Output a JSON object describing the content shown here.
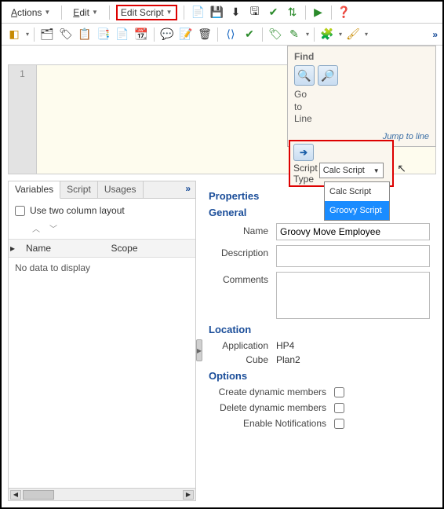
{
  "menubar": {
    "actions": "Actions",
    "actions_ul": "A",
    "edit": "Edit",
    "edit_ul": "E",
    "edit_script": "Edit Script"
  },
  "find": {
    "label": "Find",
    "go": "Go",
    "to": "to",
    "line": "Line",
    "jump": "Jump to line"
  },
  "script_type": {
    "label1": "Script",
    "label2": "Type",
    "selected": "Calc Script",
    "options": {
      "calc": "Calc Script",
      "groovy": "Groovy Script"
    }
  },
  "code": {
    "line1": "1"
  },
  "left": {
    "tabs": {
      "variables": "Variables",
      "script": "Script",
      "usages": "Usages"
    },
    "two_col": "Use two column layout",
    "cols": {
      "name": "Name",
      "scope": "Scope"
    },
    "no_data": "No data to display"
  },
  "props": {
    "properties": "Properties",
    "general": "General",
    "name_label": "Name",
    "name_value": "Groovy Move Employee",
    "description_label": "Description",
    "description_value": "",
    "comments_label": "Comments",
    "comments_value": "",
    "location": "Location",
    "application_label": "Application",
    "application_value": "HP4",
    "cube_label": "Cube",
    "cube_value": "Plan2",
    "options": "Options",
    "create_dyn": "Create dynamic members",
    "delete_dyn": "Delete dynamic members",
    "enable_notif": "Enable Notifications"
  }
}
